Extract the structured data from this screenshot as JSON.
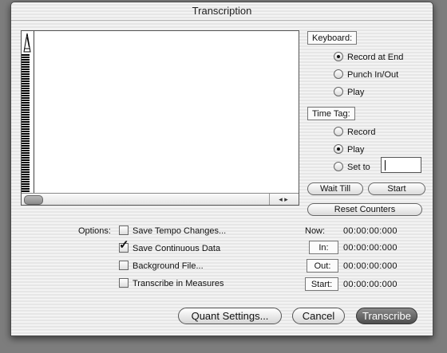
{
  "window": {
    "title": "Transcription"
  },
  "keyboard": {
    "label": "Keyboard:",
    "options": [
      {
        "label": "Record at End",
        "selected": true
      },
      {
        "label": "Punch In/Out",
        "selected": false
      },
      {
        "label": "Play",
        "selected": false
      }
    ]
  },
  "time_tag": {
    "label": "Time Tag:",
    "options": [
      {
        "label": "Record",
        "selected": false
      },
      {
        "label": "Play",
        "selected": true
      },
      {
        "label": "Set to",
        "selected": false
      }
    ],
    "set_to_value": ""
  },
  "buttons": {
    "wait_till": "Wait Till",
    "start": "Start",
    "reset_counters": "Reset Counters",
    "quant_settings": "Quant Settings...",
    "cancel": "Cancel",
    "transcribe": "Transcribe"
  },
  "options": {
    "label": "Options:",
    "items": [
      {
        "label": "Save Tempo Changes...",
        "checked": false
      },
      {
        "label": "Save Continuous Data",
        "checked": true
      },
      {
        "label": "Background File...",
        "checked": false
      },
      {
        "label": "Transcribe in Measures",
        "checked": false
      }
    ]
  },
  "counters": {
    "now_label": "Now:",
    "now_value": "00:00:00:000",
    "in_label": "In:",
    "in_value": "00:00:00:000",
    "out_label": "Out:",
    "out_value": "00:00:00:000",
    "start_label": "Start:",
    "start_value": "00:00:00:000"
  },
  "icons": {
    "metronome": "metronome-icon",
    "scroll_left": "◂",
    "scroll_right": "▸"
  }
}
